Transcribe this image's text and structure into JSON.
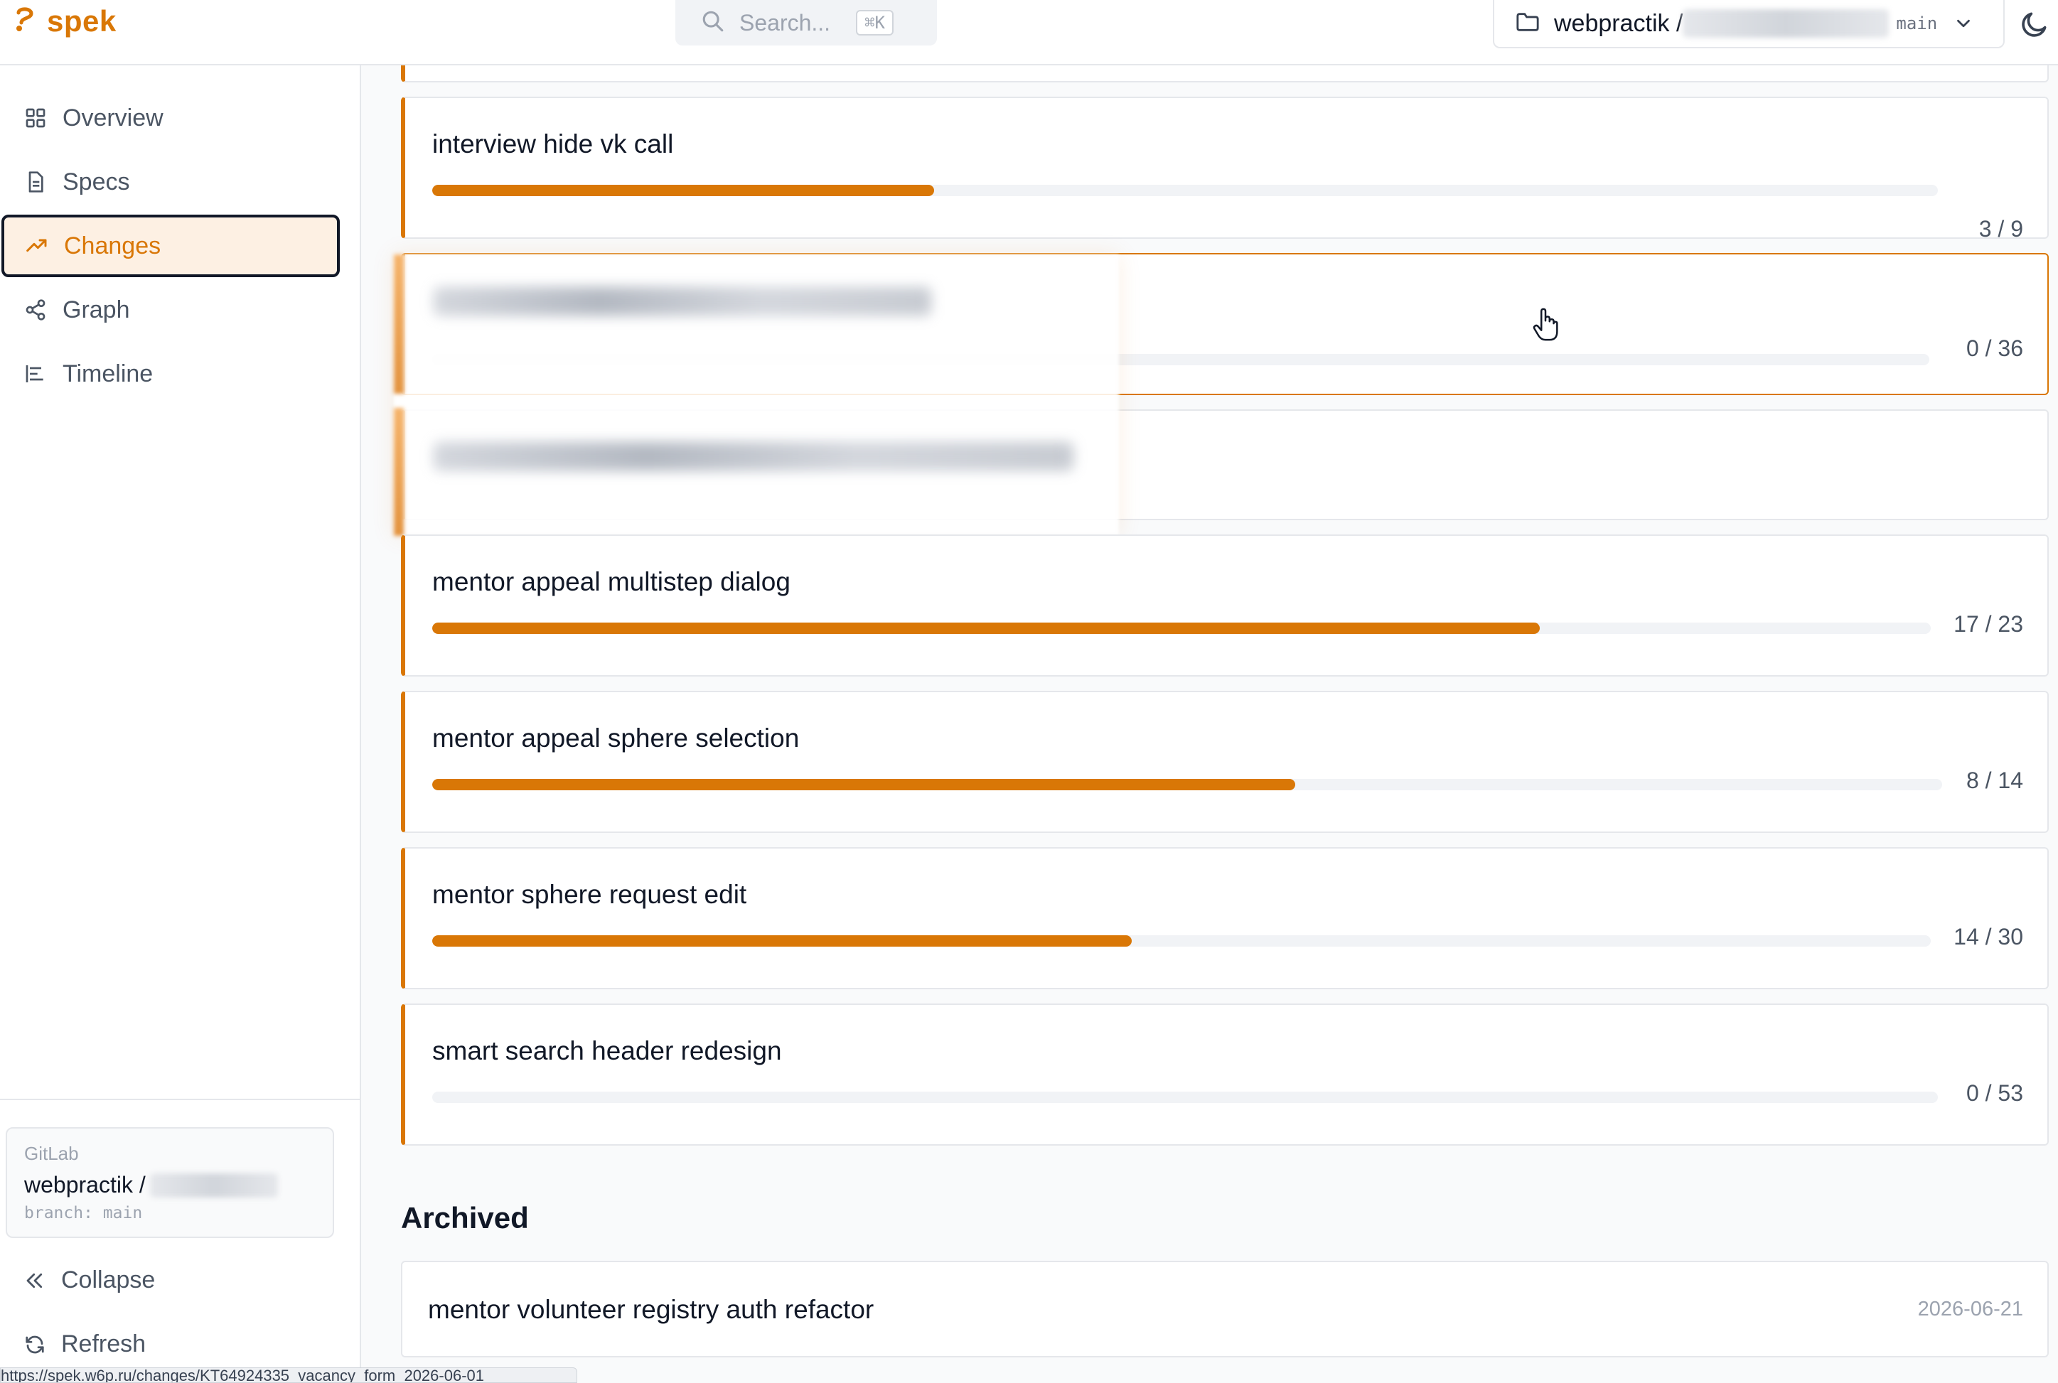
{
  "app": {
    "brand": "spek",
    "accent_color": "#d97706",
    "logo_icon": "spek-logo-icon"
  },
  "topbar": {
    "search_placeholder": "Search...",
    "search_shortcut": "⌘K",
    "repo_label": "webpractik / ",
    "branch": "main",
    "theme_icon": "moon-icon"
  },
  "sidebar": {
    "items": [
      {
        "label": "Overview",
        "icon": "grid-icon",
        "active": false
      },
      {
        "label": "Specs",
        "icon": "document-icon",
        "active": false
      },
      {
        "label": "Changes",
        "icon": "trending-up-icon",
        "active": true
      },
      {
        "label": "Graph",
        "icon": "share-nodes-icon",
        "active": false
      },
      {
        "label": "Timeline",
        "icon": "timeline-icon",
        "active": false
      }
    ],
    "gitlab": {
      "provider": "GitLab",
      "repo": "webpractik /",
      "branch": "branch: main"
    },
    "collapse_label": "Collapse",
    "refresh_label": "Refresh"
  },
  "changes": [
    {
      "title": "interview hide vk call",
      "done": 3,
      "total": 9,
      "count_label": "3 / 9"
    },
    {
      "title": "",
      "done": 0,
      "total": 36,
      "count_label": "0 / 36",
      "blurred": true,
      "hovered": true
    },
    {
      "title": "",
      "blurred": true
    },
    {
      "title": "mentor appeal multistep dialog",
      "done": 17,
      "total": 23,
      "count_label": "17 / 23"
    },
    {
      "title": "mentor appeal sphere selection",
      "done": 8,
      "total": 14,
      "count_label": "8 / 14"
    },
    {
      "title": "mentor sphere request edit",
      "done": 14,
      "total": 30,
      "count_label": "14 / 30"
    },
    {
      "title": "smart search header redesign",
      "done": 0,
      "total": 53,
      "count_label": "0 / 53"
    }
  ],
  "archived": {
    "heading": "Archived",
    "items": [
      {
        "title": "mentor volunteer registry auth refactor",
        "date": "2026-06-21"
      }
    ]
  },
  "status_bar": {
    "url": "https://spek.w6p.ru/changes/KT64924335_vacancy_form_2026-06-01"
  }
}
